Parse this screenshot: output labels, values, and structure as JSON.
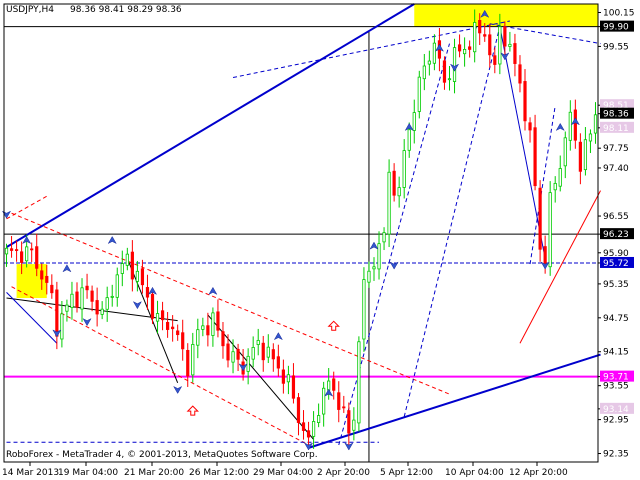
{
  "header": {
    "symbol": "USDJPY,H4",
    "ohlc": "98.36 98.41 98.29 98.36"
  },
  "footer": {
    "copyright": "RoboForex - MetaTrader 4, © 2001-2013, MetaQuotes Software Corp."
  },
  "colors": {
    "bull": "#00cc00",
    "bear": "#ff0000",
    "trendline": "#0000cc",
    "support": "#ff00ff",
    "highlight": "#ffff00",
    "level_label": "#e6c8e6"
  },
  "chart_data": {
    "type": "candlestick",
    "ylim": [
      92.2,
      100.3
    ],
    "y_ticks": [
      "100.15",
      "99.90",
      "99.55",
      "98.51",
      "98.36",
      "98.11",
      "97.75",
      "97.40",
      "96.55",
      "96.23",
      "95.90",
      "95.72",
      "95.35",
      "94.75",
      "94.15",
      "93.71",
      "93.55",
      "93.14",
      "92.95",
      "92.35"
    ],
    "x_ticks": [
      "14 Mar 2013",
      "19 Mar 04:00",
      "21 Mar 20:00",
      "26 Mar 12:00",
      "29 Mar 04:00",
      "2 Apr 20:00",
      "5 Apr 12:00",
      "10 Apr 04:00",
      "12 Apr 20:00"
    ],
    "bar_count": 118,
    "price_anchors": [
      [
        0,
        95.9
      ],
      [
        5,
        95.9
      ],
      [
        9,
        95.1
      ],
      [
        10,
        94.6
      ],
      [
        13,
        95.1
      ],
      [
        16,
        95.2
      ],
      [
        19,
        94.8
      ],
      [
        22,
        95.5
      ],
      [
        24,
        95.8
      ],
      [
        27,
        95.3
      ],
      [
        30,
        94.7
      ],
      [
        33,
        94.6
      ],
      [
        36,
        93.9
      ],
      [
        38,
        94.5
      ],
      [
        41,
        94.7
      ],
      [
        44,
        94.1
      ],
      [
        47,
        93.9
      ],
      [
        50,
        94.3
      ],
      [
        53,
        94.0
      ],
      [
        56,
        93.6
      ],
      [
        58,
        93.0
      ],
      [
        60,
        92.55
      ],
      [
        62,
        93.2
      ],
      [
        64,
        93.6
      ],
      [
        66,
        93.3
      ],
      [
        68,
        92.7
      ],
      [
        69,
        93.0
      ],
      [
        70,
        94.4
      ],
      [
        71,
        95.3
      ],
      [
        73,
        95.8
      ],
      [
        75,
        96.2
      ],
      [
        76,
        97.3
      ],
      [
        78,
        96.9
      ],
      [
        79,
        97.7
      ],
      [
        81,
        98.5
      ],
      [
        83,
        99.2
      ],
      [
        85,
        99.6
      ],
      [
        87,
        98.9
      ],
      [
        89,
        99.4
      ],
      [
        91,
        99.5
      ],
      [
        93,
        99.8
      ],
      [
        95,
        99.8
      ],
      [
        97,
        99.1
      ],
      [
        98,
        99.9
      ],
      [
        100,
        99.5
      ],
      [
        102,
        98.9
      ],
      [
        104,
        97.9
      ],
      [
        105,
        97.1
      ],
      [
        106,
        96.0
      ],
      [
        107,
        95.8
      ],
      [
        108,
        96.8
      ],
      [
        110,
        97.5
      ],
      [
        112,
        98.3
      ],
      [
        114,
        97.5
      ],
      [
        116,
        98.0
      ],
      [
        117,
        98.36
      ]
    ],
    "horizontal_levels": [
      {
        "price": 99.9,
        "label": "99.90",
        "color": "#000000"
      },
      {
        "price": 96.23,
        "label": "96.23",
        "color": "#000000"
      },
      {
        "price": 95.72,
        "label": "95.72",
        "color": "#0000cc"
      },
      {
        "price": 93.71,
        "label": "93.71",
        "color": "#ff00ff"
      }
    ],
    "level_labels": [
      "98.51",
      "98.36",
      "98.11",
      "93.14"
    ],
    "highlight_zones": [
      {
        "from_bar": 81,
        "to_bar": 118,
        "top": 100.3,
        "bottom": 99.9
      },
      {
        "from_bar": 2,
        "to_bar": 8,
        "top": 95.7,
        "bottom": 95.1
      }
    ],
    "cursor_bar": 72,
    "trendlines": [
      {
        "from": [
          0,
          96.0
        ],
        "to": [
          81,
          100.3
        ],
        "style": "solid",
        "color": "#0000cc",
        "width": 2
      },
      {
        "from": [
          60,
          92.45
        ],
        "to": [
          118,
          94.1
        ],
        "style": "solid",
        "color": "#0000cc",
        "width": 2
      },
      {
        "from": [
          102,
          94.3
        ],
        "to": [
          118,
          97.0
        ],
        "style": "solid",
        "color": "#ff0000",
        "width": 1
      },
      {
        "from": [
          0,
          95.1
        ],
        "to": [
          34,
          94.7
        ],
        "style": "solid",
        "color": "#000000",
        "width": 1
      },
      {
        "from": [
          24,
          95.8
        ],
        "to": [
          34,
          93.6
        ],
        "style": "solid",
        "color": "#000000",
        "width": 1
      },
      {
        "from": [
          40,
          94.8
        ],
        "to": [
          61,
          92.6
        ],
        "style": "solid",
        "color": "#000000",
        "width": 1
      },
      {
        "from": [
          98,
          99.9
        ],
        "to": [
          107,
          95.8
        ],
        "style": "solid",
        "color": "#0000cc",
        "width": 1
      },
      {
        "from": [
          0,
          95.2
        ],
        "to": [
          10,
          94.3
        ],
        "style": "solid",
        "color": "#0000cc",
        "width": 1
      },
      {
        "from": [
          1,
          96.6
        ],
        "to": [
          88,
          93.4
        ],
        "style": "dashed",
        "color": "#ff0000",
        "width": 1
      },
      {
        "from": [
          1,
          95.3
        ],
        "to": [
          60,
          92.5
        ],
        "style": "dashed",
        "color": "#ff0000",
        "width": 1
      },
      {
        "from": [
          45,
          99.0
        ],
        "to": [
          100,
          100.0
        ],
        "style": "dashed",
        "color": "#0000cc",
        "width": 1
      },
      {
        "from": [
          96,
          99.95
        ],
        "to": [
          118,
          99.6
        ],
        "style": "dashed",
        "color": "#0000cc",
        "width": 1
      },
      {
        "from": [
          66,
          92.5
        ],
        "to": [
          88,
          99.6
        ],
        "style": "dashed",
        "color": "#0000cc",
        "width": 1
      },
      {
        "from": [
          79,
          93.0
        ],
        "to": [
          98,
          99.9
        ],
        "style": "dashed",
        "color": "#0000cc",
        "width": 1
      },
      {
        "from": [
          0,
          96.5
        ],
        "to": [
          8,
          96.9
        ],
        "style": "dashed",
        "color": "#ff0000",
        "width": 1
      },
      {
        "from": [
          104,
          95.7
        ],
        "to": [
          109,
          98.5
        ],
        "style": "dashed",
        "color": "#0000cc",
        "width": 1
      },
      {
        "from": [
          0,
          92.55
        ],
        "to": [
          74,
          92.55
        ],
        "style": "dashed",
        "color": "#0000cc",
        "width": 1
      }
    ],
    "wave_arrows": [
      [
        0,
        96.6,
        "down"
      ],
      [
        4,
        96.1,
        "up"
      ],
      [
        10,
        94.5,
        "down"
      ],
      [
        12,
        95.6,
        "up"
      ],
      [
        16,
        94.7,
        "down"
      ],
      [
        21,
        96.1,
        "up"
      ],
      [
        26,
        95.0,
        "down"
      ],
      [
        29,
        95.2,
        "up"
      ],
      [
        34,
        93.5,
        "down"
      ],
      [
        41,
        95.2,
        "up"
      ],
      [
        47,
        93.9,
        "down"
      ],
      [
        54,
        94.4,
        "up"
      ],
      [
        60,
        92.5,
        "down"
      ],
      [
        64,
        93.4,
        "up"
      ],
      [
        68,
        92.5,
        "down"
      ],
      [
        73,
        96.0,
        "up"
      ],
      [
        77,
        95.7,
        "down"
      ],
      [
        80,
        98.1,
        "up"
      ],
      [
        86,
        99.5,
        "up"
      ],
      [
        89,
        99.2,
        "down"
      ],
      [
        95,
        100.1,
        "up"
      ],
      [
        99,
        99.4,
        "down"
      ],
      [
        107,
        95.7,
        "down"
      ],
      [
        110,
        98.1,
        "up"
      ],
      [
        113,
        98.2,
        "up"
      ]
    ],
    "hollow_arrows": [
      [
        37,
        93.1
      ],
      [
        65,
        94.6
      ]
    ]
  }
}
